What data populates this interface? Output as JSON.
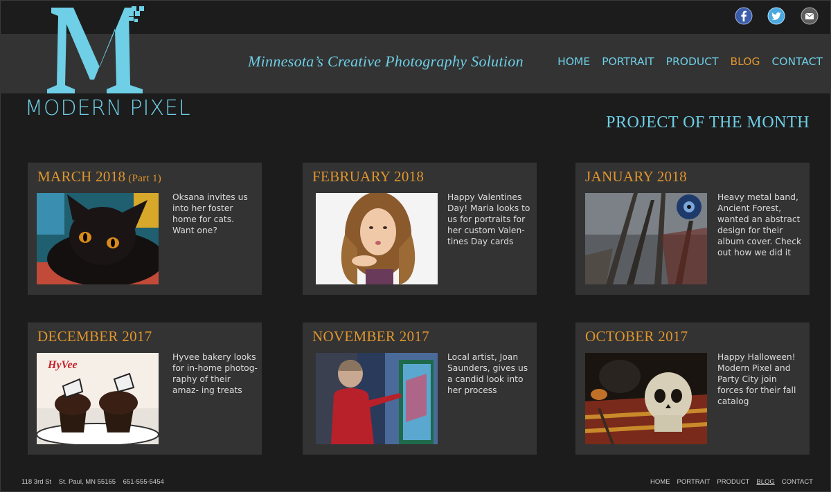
{
  "brand": {
    "name": "MODERN PIXEL",
    "tagline": "Minnesota’s Creative Photography Solution",
    "accent": "#6ecfe6",
    "highlight": "#e0962e"
  },
  "social": [
    {
      "icon": "facebook-icon",
      "color": "#3b5ca8"
    },
    {
      "icon": "twitter-icon",
      "color": "#4aa9e0"
    },
    {
      "icon": "email-icon",
      "color": "#8a8a8a"
    }
  ],
  "nav": {
    "items": [
      "HOME",
      "PORTRAIT",
      "PRODUCT",
      "BLOG",
      "CONTACT"
    ],
    "active": "BLOG"
  },
  "section_title": "PROJECT OF THE MONTH",
  "cards": [
    {
      "title": "MARCH 2018",
      "subtitle": "(Part 1)",
      "text": "Oksana invites us into her foster home for cats. Want one?"
    },
    {
      "title": "FEBRUARY 2018",
      "text": "Happy Valentines Day! Maria looks to us for portraits for her custom Valen- tines Day cards"
    },
    {
      "title": "JANUARY 2018",
      "text": "Heavy metal band, Ancient Forest, wanted an abstract design for their album cover. Check out how we did it"
    },
    {
      "title": "DECEMBER 2017",
      "text": "Hyvee bakery looks for in-home photog- raphy of their amaz- ing treats"
    },
    {
      "title": "NOVEMBER 2017",
      "text": "Local artist, Joan Saunders, gives us a candid look into her process"
    },
    {
      "title": "OCTOBER 2017",
      "text": "Happy Halloween! Modern Pixel and Party City join forces for their fall catalog"
    }
  ],
  "images": {
    "hyvee_logo": "HyVee"
  },
  "footer": {
    "address": "118 3rd St    St. Paul, MN 55165    651-555-5454",
    "nav": [
      "HOME",
      "PORTRAIT",
      "PRODUCT",
      "BLOG",
      "CONTACT"
    ]
  }
}
